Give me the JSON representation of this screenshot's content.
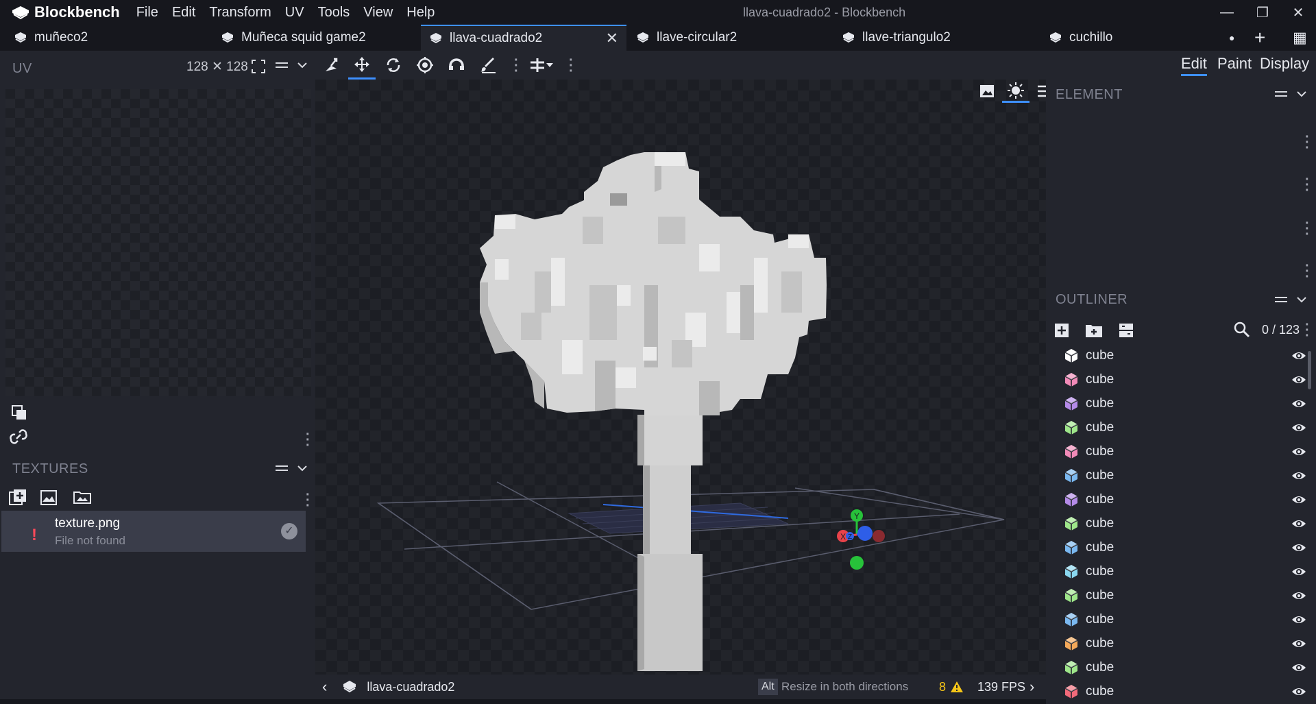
{
  "app": {
    "name": "Blockbench",
    "window_title": "llava-cuadrado2 - Blockbench",
    "menu": [
      "File",
      "Edit",
      "Transform",
      "UV",
      "Tools",
      "View",
      "Help"
    ],
    "window_controls": {
      "minimize": "—",
      "restore": "❐",
      "close": "✕"
    }
  },
  "tabs": [
    {
      "label": "muñeco2",
      "active": false
    },
    {
      "label": "Muñeca squid game2",
      "active": false
    },
    {
      "label": "llava-cuadrado2",
      "active": true
    },
    {
      "label": "llave-circular2",
      "active": false
    },
    {
      "label": "llave-triangulo2",
      "active": false
    },
    {
      "label": "cuchillo",
      "active": false
    }
  ],
  "tab_close": "✕",
  "tab_extras": {
    "dot": "●",
    "plus": "+",
    "grid": "▦"
  },
  "uv_panel": {
    "title": "UV",
    "size": "128 ✕ 128"
  },
  "textures_panel": {
    "title": "TEXTURES",
    "items": [
      {
        "name": "texture.png",
        "status": "File not found",
        "error_mark": "!"
      }
    ]
  },
  "mode_tabs": [
    "Edit",
    "Paint",
    "Display"
  ],
  "active_mode": "Edit",
  "element_panel": {
    "title": "ELEMENT"
  },
  "outliner": {
    "title": "OUTLINER",
    "count": "0 / 123",
    "items": [
      {
        "label": "cube",
        "color": "#ffffff"
      },
      {
        "label": "cube",
        "color": "#f28ab8"
      },
      {
        "label": "cube",
        "color": "#b48ae8"
      },
      {
        "label": "cube",
        "color": "#9ee68a"
      },
      {
        "label": "cube",
        "color": "#f28ab8"
      },
      {
        "label": "cube",
        "color": "#7ab8f0"
      },
      {
        "label": "cube",
        "color": "#b48ae8"
      },
      {
        "label": "cube",
        "color": "#9ee68a"
      },
      {
        "label": "cube",
        "color": "#7ab8f0"
      },
      {
        "label": "cube",
        "color": "#8ad8f0"
      },
      {
        "label": "cube",
        "color": "#9ee68a"
      },
      {
        "label": "cube",
        "color": "#7ab8f0"
      },
      {
        "label": "cube",
        "color": "#f2a85a"
      },
      {
        "label": "cube",
        "color": "#9ee68a"
      },
      {
        "label": "cube",
        "color": "#f26a7a"
      }
    ]
  },
  "status": {
    "model_name": "llava-cuadrado2",
    "key_hint": "Alt",
    "hint": "Resize in both directions",
    "warnings": "8",
    "fps": "139 FPS"
  },
  "axes": {
    "x": "X",
    "y": "Y",
    "z": "Z"
  },
  "colors": {
    "accent": "#3e90ff",
    "error": "#ff4a5a",
    "warning": "#f5c518"
  }
}
